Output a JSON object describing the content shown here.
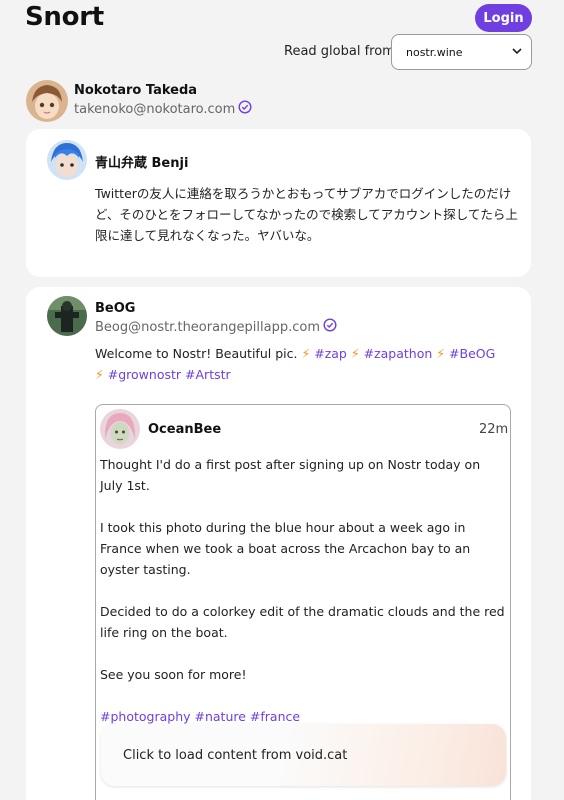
{
  "app": {
    "title": "Snort",
    "login_label": "Login"
  },
  "relay": {
    "label": "Read global from",
    "selected": "nostr.wine"
  },
  "profile": {
    "name": "Nokotaro Takeda",
    "nip05": "takenoko@nokotaro.com"
  },
  "notes": [
    {
      "author": "青山弁蔵 Benji",
      "content": "Twitterの友人に連絡を取ろうかとおもってサブアカでログインしたのだけど、そのひとをフォローしてなかったので検索してアカウント探してたら上限に達して見れなくなった。ヤバいな。"
    },
    {
      "author": "BeOG",
      "nip05": "Beog@nostr.theorangepillapp.com",
      "content_intro": "Welcome to Nostr! Beautiful pic.",
      "tags": [
        "#zap",
        "#zapathon",
        "#BeOG",
        "#grownostr",
        "#Artstr"
      ],
      "quote": {
        "author": "OceanBee",
        "time": "22m",
        "paragraphs": [
          "Thought I'd do a first post after signing up on Nostr today on July 1st.",
          "I took this photo during the blue hour about a week ago in France when we took a boat across the Arcachon bay to an oyster tasting.",
          "Decided to do a colorkey edit of the dramatic clouds and the red life ring on the boat.",
          "See you soon for more!"
        ],
        "tags": [
          "#photography",
          "#nature",
          "#france"
        ],
        "load_label": "Click to load content from void.cat"
      }
    }
  ],
  "colors": {
    "accent": "#6f3fe0",
    "bolt": "#f7931a",
    "background": "#f3f3f3"
  }
}
